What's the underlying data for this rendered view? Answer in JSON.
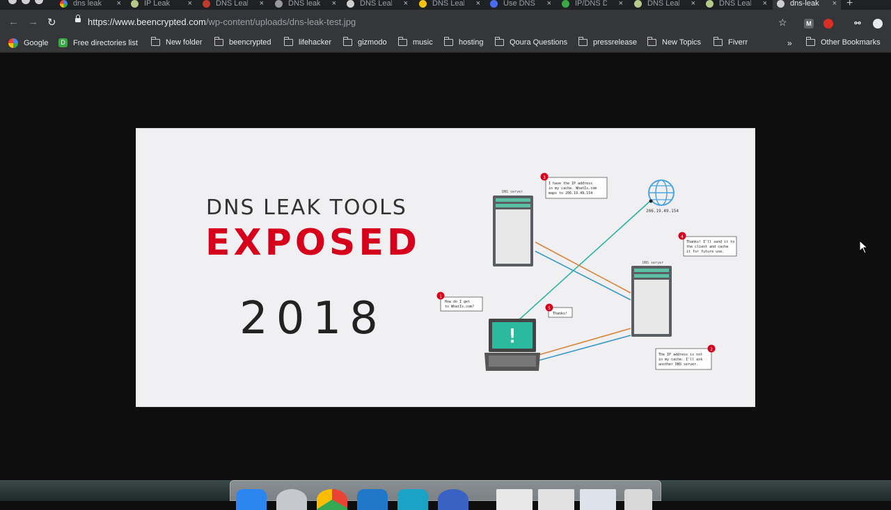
{
  "browser": {
    "tabs": [
      {
        "title": "dns leak",
        "favicon": "google-icon",
        "active": false
      },
      {
        "title": "IP Leak",
        "favicon": "shield-icon",
        "active": false
      },
      {
        "title": "DNS Leak",
        "favicon": "red-shield-icon",
        "active": false
      },
      {
        "title": "DNS leak",
        "favicon": "tool-icon",
        "active": false
      },
      {
        "title": "DNS Leak",
        "favicon": "page-icon",
        "active": false
      },
      {
        "title": "DNS Leak",
        "favicon": "lightning-icon",
        "active": false
      },
      {
        "title": "Use DNS",
        "favicon": "blue-icon",
        "active": false
      },
      {
        "title": "IP/DNS D",
        "favicon": "green-icon",
        "active": false
      },
      {
        "title": "DNS Leak",
        "favicon": "shield-icon",
        "active": false
      },
      {
        "title": "DNS Leak",
        "favicon": "shield-icon",
        "active": false
      },
      {
        "title": "dns-leak",
        "favicon": "page-icon",
        "active": true
      }
    ],
    "address": {
      "host": "https://www.beencrypted.com",
      "path": "/wp-content/uploads/dns-leak-test.jpg"
    },
    "bookmarks": [
      {
        "label": "Google",
        "icon": "google-icon"
      },
      {
        "label": "Free directories list",
        "icon": "directory-icon"
      },
      {
        "label": "New folder",
        "icon": "folder-icon"
      },
      {
        "label": "beencrypted",
        "icon": "folder-icon"
      },
      {
        "label": "lifehacker",
        "icon": "folder-icon"
      },
      {
        "label": "gizmodo",
        "icon": "folder-icon"
      },
      {
        "label": "music",
        "icon": "folder-icon"
      },
      {
        "label": "hosting",
        "icon": "folder-icon"
      },
      {
        "label": "Qoura Questions",
        "icon": "folder-icon"
      },
      {
        "label": "pressrelease",
        "icon": "folder-icon"
      },
      {
        "label": "New Topics",
        "icon": "folder-icon"
      },
      {
        "label": "Fiverr",
        "icon": "folder-icon"
      }
    ],
    "overflow_label": "»",
    "other_bookmarks": "Other Bookmarks",
    "extension_m": "M"
  },
  "image": {
    "line1": "DNS LEAK TOOLS",
    "line2": "EXPOSED",
    "line3": "2018",
    "accent_color": "#d6001c",
    "diagram": {
      "dns_server_label": "DNS server",
      "ip": "206.19.49.154",
      "bubble1_num": "1",
      "bubble1_l1": "How do I get",
      "bubble1_l2": "to WhatIs.com?",
      "bubble2_num": "2",
      "bubble2_l1": "The IP address is not",
      "bubble2_l2": "in my cache. I'll ask",
      "bubble2_l3": "another DNS server.",
      "bubble3_num": "3",
      "bubble3_l1": "I have the IP address",
      "bubble3_l2": "in my cache. WhatIs.com",
      "bubble3_l3": "maps to 206.19.49.154",
      "bubble4_num": "4",
      "bubble4_l1": "Thanks! I'll send it to",
      "bubble4_l2": "the client and cache",
      "bubble4_l3": "it for future use.",
      "bubble5_num": "5",
      "bubble5_l1": "Thanks!",
      "laptop_mark": "!"
    }
  }
}
